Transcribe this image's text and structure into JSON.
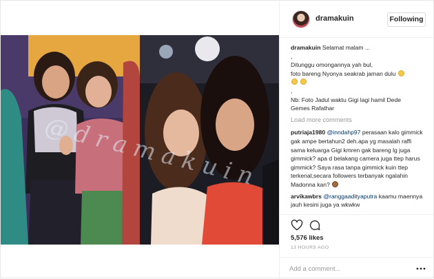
{
  "post": {
    "username": "dramakuin",
    "follow_label": "Following",
    "watermark": "@dramakuin",
    "caption_lines": [
      "Selamat malam ...",
      ",",
      "Ditunggu omongannya yah bul,",
      "foto bareng Nyonya seakrab jaman dulu",
      "",
      ",",
      "Nb: Foto Jadul waktu Gigi lagi hamil Dede",
      "Gemes Rafathar"
    ],
    "load_more": "Load more comments",
    "comments": [
      {
        "user": "putriaja1980",
        "mention": "@inndahp97",
        "text": "perasaan kalo gimmick gak ampe bertahun2 deh.apa yg masalah raffi sama keluarga Gigi kmren gak bareng lg juga gimmick? apa d belakang camera juga ttep harus gimmick? Saya rasa tanpa gimmick kuin ttep terkenal,secara followers terbanyak ngalahin Madonna kan?"
      },
      {
        "user": "arvikawbrs",
        "mention": "@ranggaadityaputra",
        "text": "kaamu maennya jauh kesini juga ya wkwkw"
      }
    ],
    "likes": "5,576 likes",
    "time": "13 HOURS AGO",
    "add_comment_placeholder": "Add a comment..."
  },
  "icons": {
    "heart": "heart-icon",
    "comment": "comment-icon",
    "more": "more-icon"
  },
  "colors": {
    "accent_text": "#262626",
    "muted_text": "#999999",
    "mention": "#003569",
    "border": "#efefef"
  }
}
